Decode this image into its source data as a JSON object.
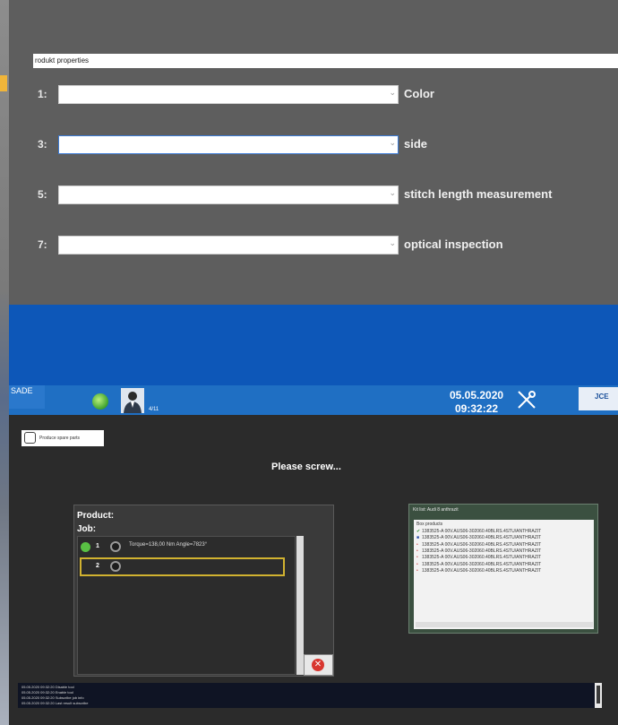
{
  "properties": {
    "header": "rodukt properties",
    "rows": [
      {
        "num": "1:",
        "label": "Color"
      },
      {
        "num": "3:",
        "label": "side"
      },
      {
        "num": "5:",
        "label": "stitch length measurement"
      },
      {
        "num": "7:",
        "label": "optical inspection"
      }
    ]
  },
  "header": {
    "logo_title": "SADE",
    "logo_sub": "",
    "logo_small": "",
    "count": "4/11",
    "date": "05.05.2020",
    "time": "09:32:22",
    "right_logo": "JCE"
  },
  "work": {
    "spare_parts_label": "Produce spare parts",
    "prompt": "Please screw...",
    "product_label": "Product:",
    "job_label": "Job:",
    "rows": [
      {
        "num": "1",
        "info": "Torque=138,00 Nm  Angle=7823°"
      },
      {
        "num": "2",
        "info": ""
      }
    ]
  },
  "kit": {
    "title": "Kit list: Audi 8 anthrazit",
    "header": "Box products",
    "items": [
      {
        "mark": "✔",
        "text": "1383525-A 00V.AUS06-302060.40BLRS.4STU/ANTHRAZIT"
      },
      {
        "mark": "■",
        "text": "1383525-A 00V.AUS06-302060.40BLRS.4STU/ANTHRAZIT"
      },
      {
        "mark": "•",
        "text": "1383525-A 00V.AUS06-302060.40BLRS.4STU/ANTHRAZIT"
      },
      {
        "mark": "•",
        "text": "1383525-A 00V.AUS06-302060.40BLRS.4STU/ANTHRAZIT"
      },
      {
        "mark": "•",
        "text": "1383525-A 00V.AUS06-302060.40BLRS.4STU/ANTHRAZIT"
      },
      {
        "mark": "•",
        "text": "1383525-A 00V.AUS06-302060.40BLRS.4STU/ANTHRAZIT"
      },
      {
        "mark": "•",
        "text": "1383525-A 00V.AUS06-302060.40BLRS.4STU/ANTHRAZIT"
      }
    ]
  },
  "log": [
    "05.05.2020 09:32:20 Disable tool",
    "05.05.2020 09:32:20 Enable tool",
    "05.05.2020 09:32:20 Subscribe job info",
    "05.05.2020 09:32:20 Last result subscribe"
  ],
  "colors": {
    "top_panel": "#5e5e5e",
    "blue_band": "#0d57b8",
    "header_bar": "#1f6fc3",
    "work_bg": "#2b2b2b",
    "highlight_box": "#d1b230",
    "kit_panel": "#3b5040"
  },
  "icons": {
    "status": "green-circle-icon",
    "user": "operator-avatar-icon",
    "tools": "wrench-screwdriver-icon",
    "cancel": "close-icon",
    "screw": "screw-icon",
    "ok": "check-circle-icon"
  }
}
